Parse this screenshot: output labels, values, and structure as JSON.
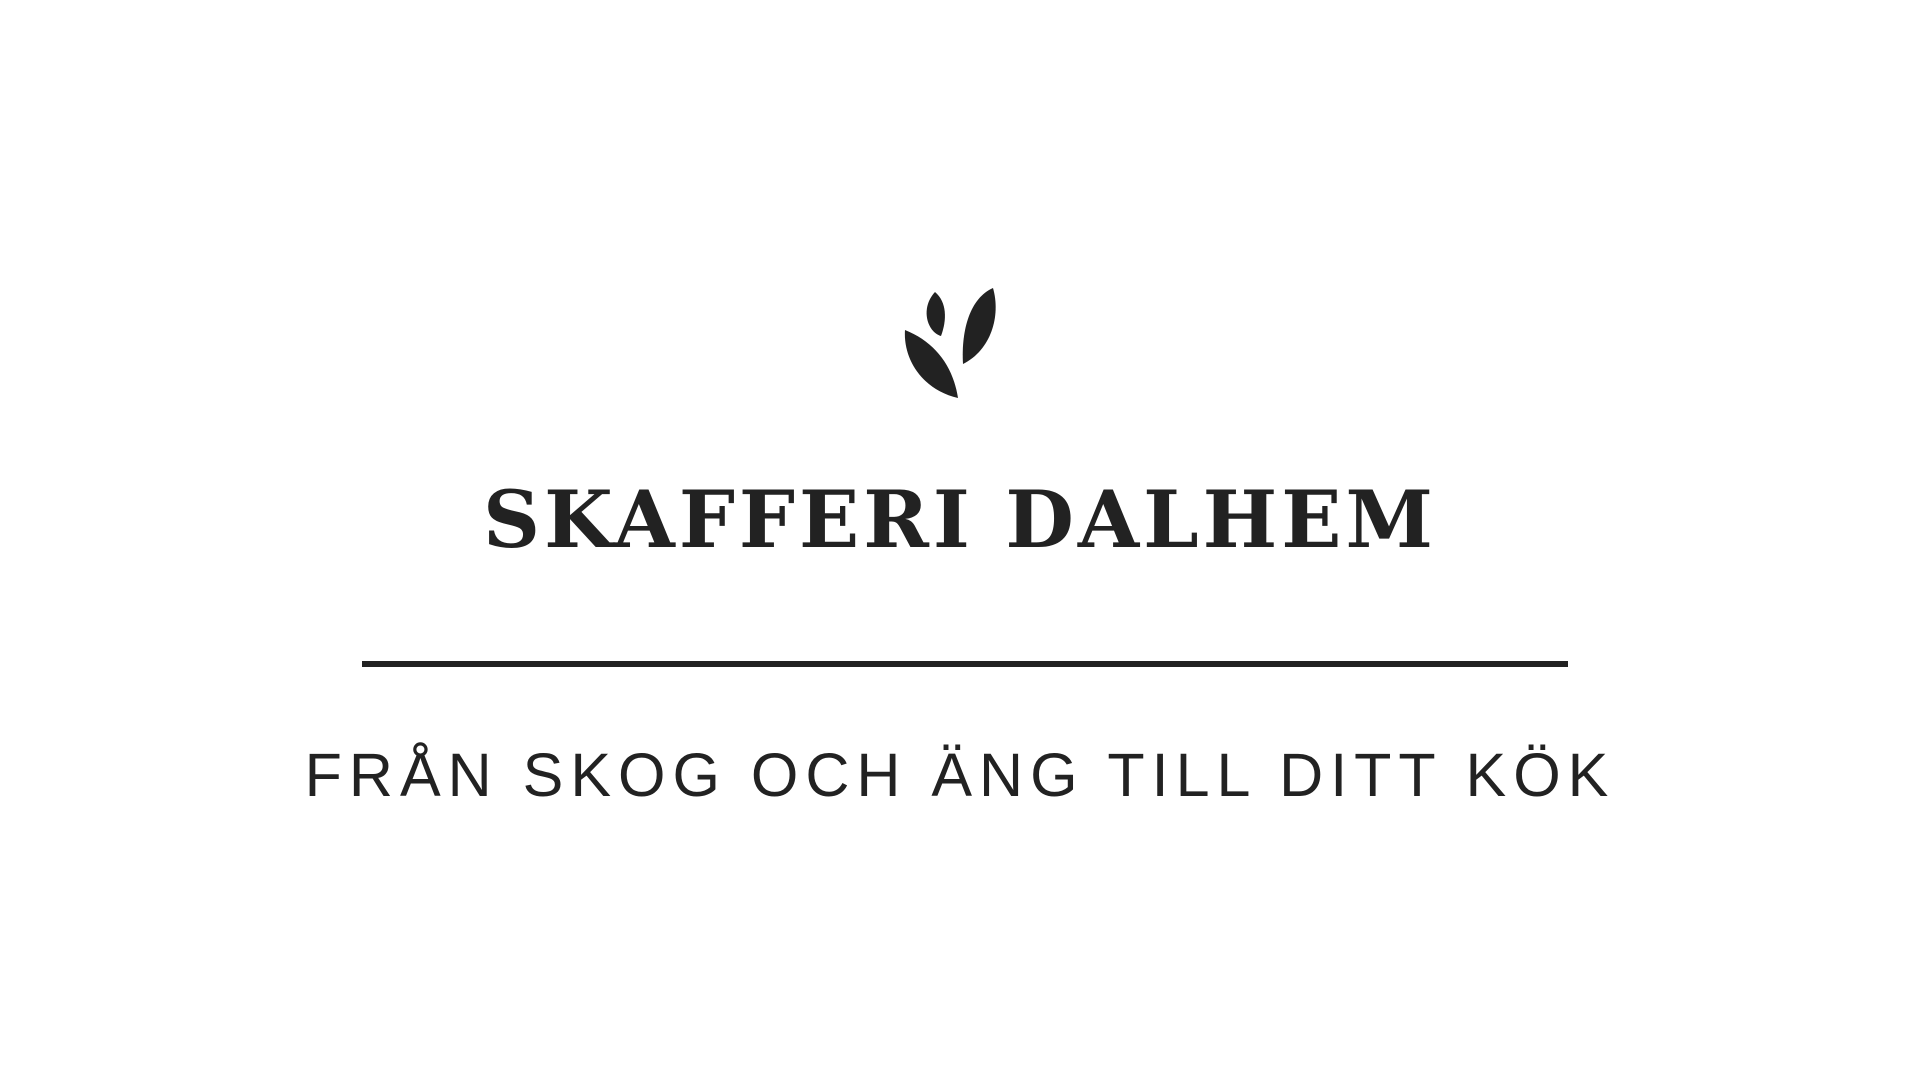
{
  "brand": {
    "name": "SKAFFERI DALHEM",
    "tagline": "FRÅN SKOG OCH ÄNG TILL DITT KÖK",
    "logo_icon": "leaf-sprout-icon"
  },
  "colors": {
    "ink": "#222222",
    "background": "#ffffff"
  }
}
